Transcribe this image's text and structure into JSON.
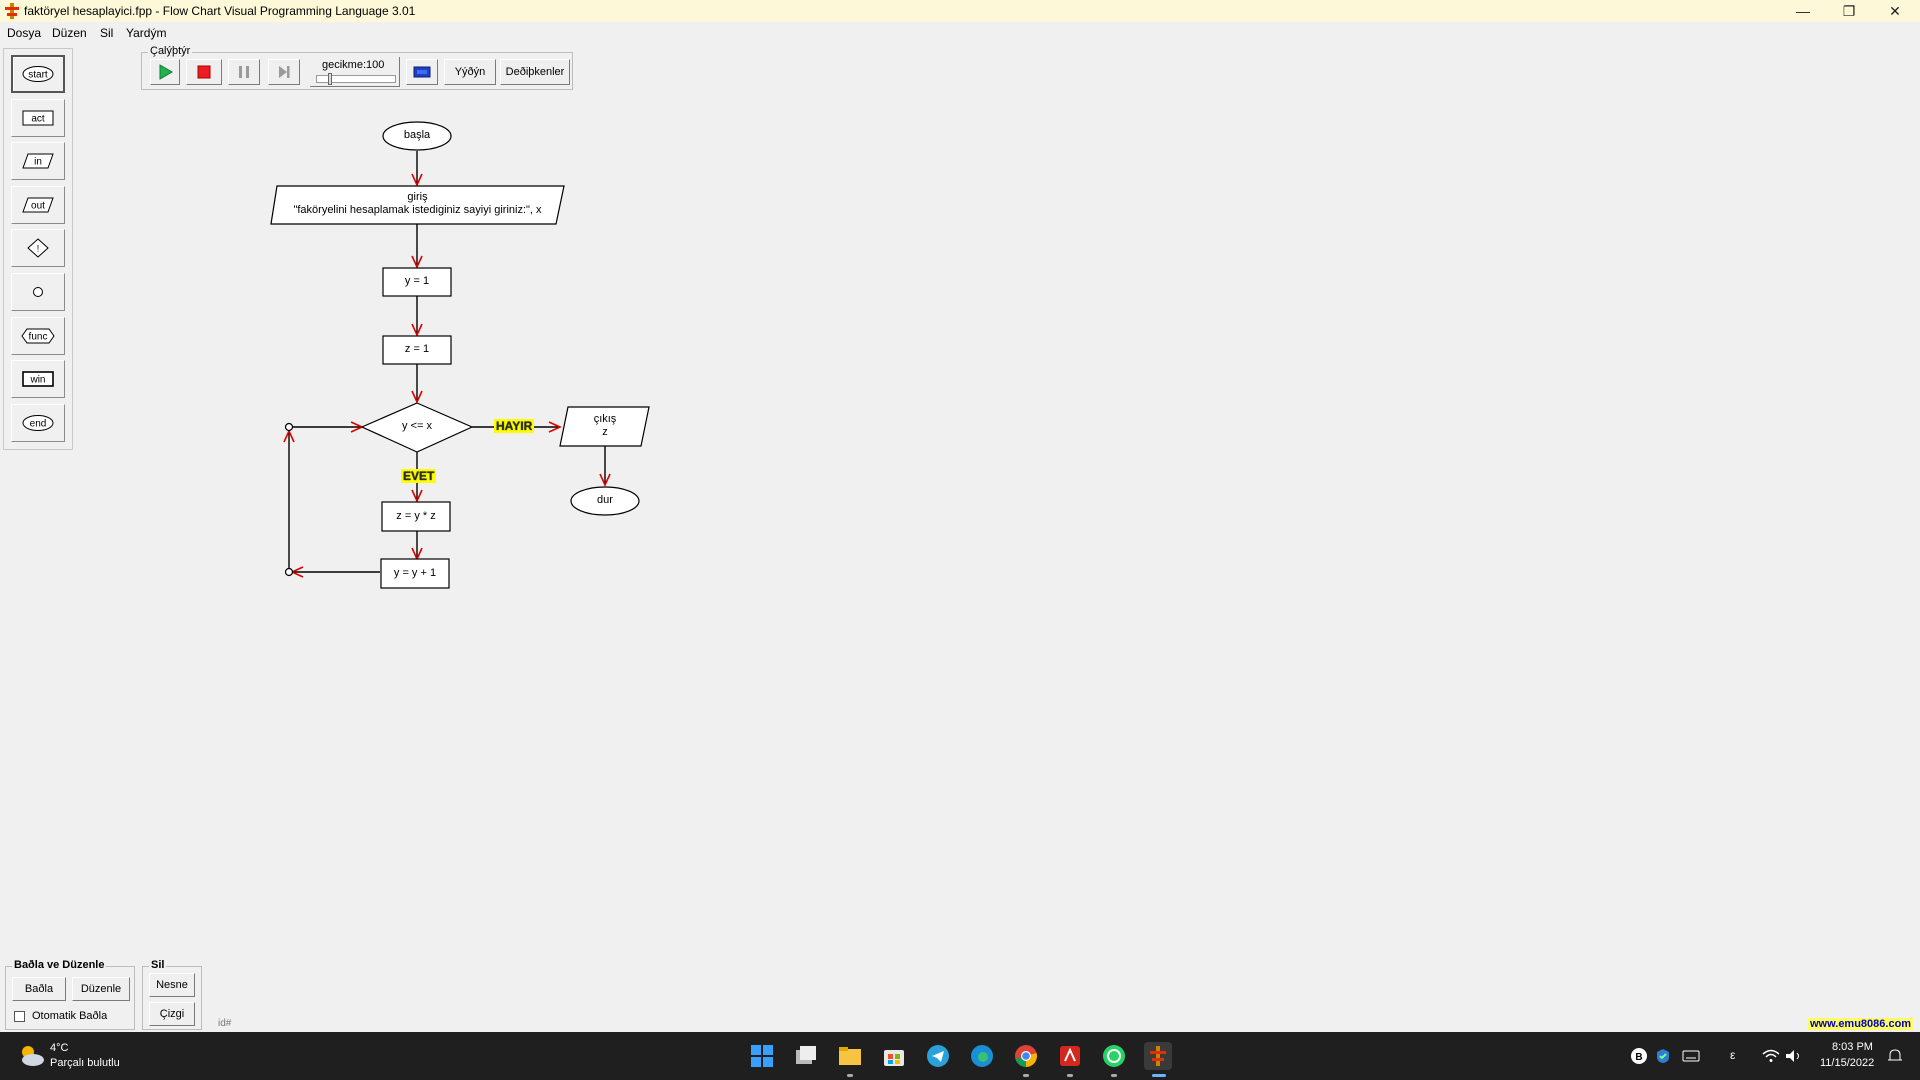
{
  "window": {
    "title": "faktöryel hesaplayici.fpp - Flow Chart Visual Programming Language 3.01",
    "minimize_glyph": "—",
    "restore_glyph": "❐",
    "close_glyph": "✕"
  },
  "menu": [
    "Dosya",
    "Düzen",
    "Sil",
    "Yardým"
  ],
  "toolbox": {
    "items": [
      {
        "id": "start",
        "label": "start",
        "shape": "ellipse"
      },
      {
        "id": "act",
        "label": "act",
        "shape": "rect"
      },
      {
        "id": "in",
        "label": "in",
        "shape": "parallelogram"
      },
      {
        "id": "out",
        "label": "out",
        "shape": "parallelogram"
      },
      {
        "id": "if",
        "label": "!",
        "shape": "diamond"
      },
      {
        "id": "connector",
        "label": "",
        "shape": "circle"
      },
      {
        "id": "func",
        "label": "func",
        "shape": "hexagon"
      },
      {
        "id": "win",
        "label": "win",
        "shape": "rect"
      },
      {
        "id": "end",
        "label": "end",
        "shape": "ellipse"
      }
    ],
    "selected": "start"
  },
  "run": {
    "group_label": "Çalýþtýr",
    "delay_label": "gecikme:100",
    "delay_fraction": 0.15,
    "step_in_label": "Yýðýn",
    "variables_label": "Deðiþkenler",
    "colors": {
      "play": "#22b14c",
      "stop": "#ed1c24",
      "memory": "#1f3fbf"
    }
  },
  "flowchart": {
    "start_label": "başla",
    "input_label": "giriş\n\"faköryelini hesaplamak istediginiz sayiyi giriniz:\", x",
    "assign_y": "y = 1",
    "assign_z": "z = 1",
    "condition": "y <= x",
    "yes_label": "EVET",
    "no_label": "HAYIR",
    "multiply": "z = y * z",
    "increment": "y = y + 1",
    "output_label": "çıkış\nz",
    "end_label": "dur",
    "arrow_color": "#e00000",
    "tag_color": "#ffff00"
  },
  "bottom": {
    "connect_group_label": "Baðla ve Düzenle",
    "connect_label": "Baðla",
    "arrange_label": "Düzenle",
    "auto_connect_label": "Otomatik Baðla",
    "auto_connect_checked": false,
    "delete_group_label": "Sil",
    "delete_object_label": "Nesne",
    "delete_line_label": "Çizgi",
    "id_label": "id#",
    "watermark": "www.emu8086.com"
  },
  "taskbar": {
    "weather_temp": "4°C",
    "weather_desc": "Parçalı bulutlu",
    "apps": [
      "start-icon",
      "task-view-icon",
      "file-explorer-icon",
      "store-icon",
      "telegram-icon",
      "edge-icon",
      "chrome-icon",
      "acrobat-icon",
      "whatsapp-icon",
      "flowchart-app-icon"
    ],
    "time": "8:03 PM",
    "date": "11/15/2022",
    "tray_lang": "ε"
  }
}
